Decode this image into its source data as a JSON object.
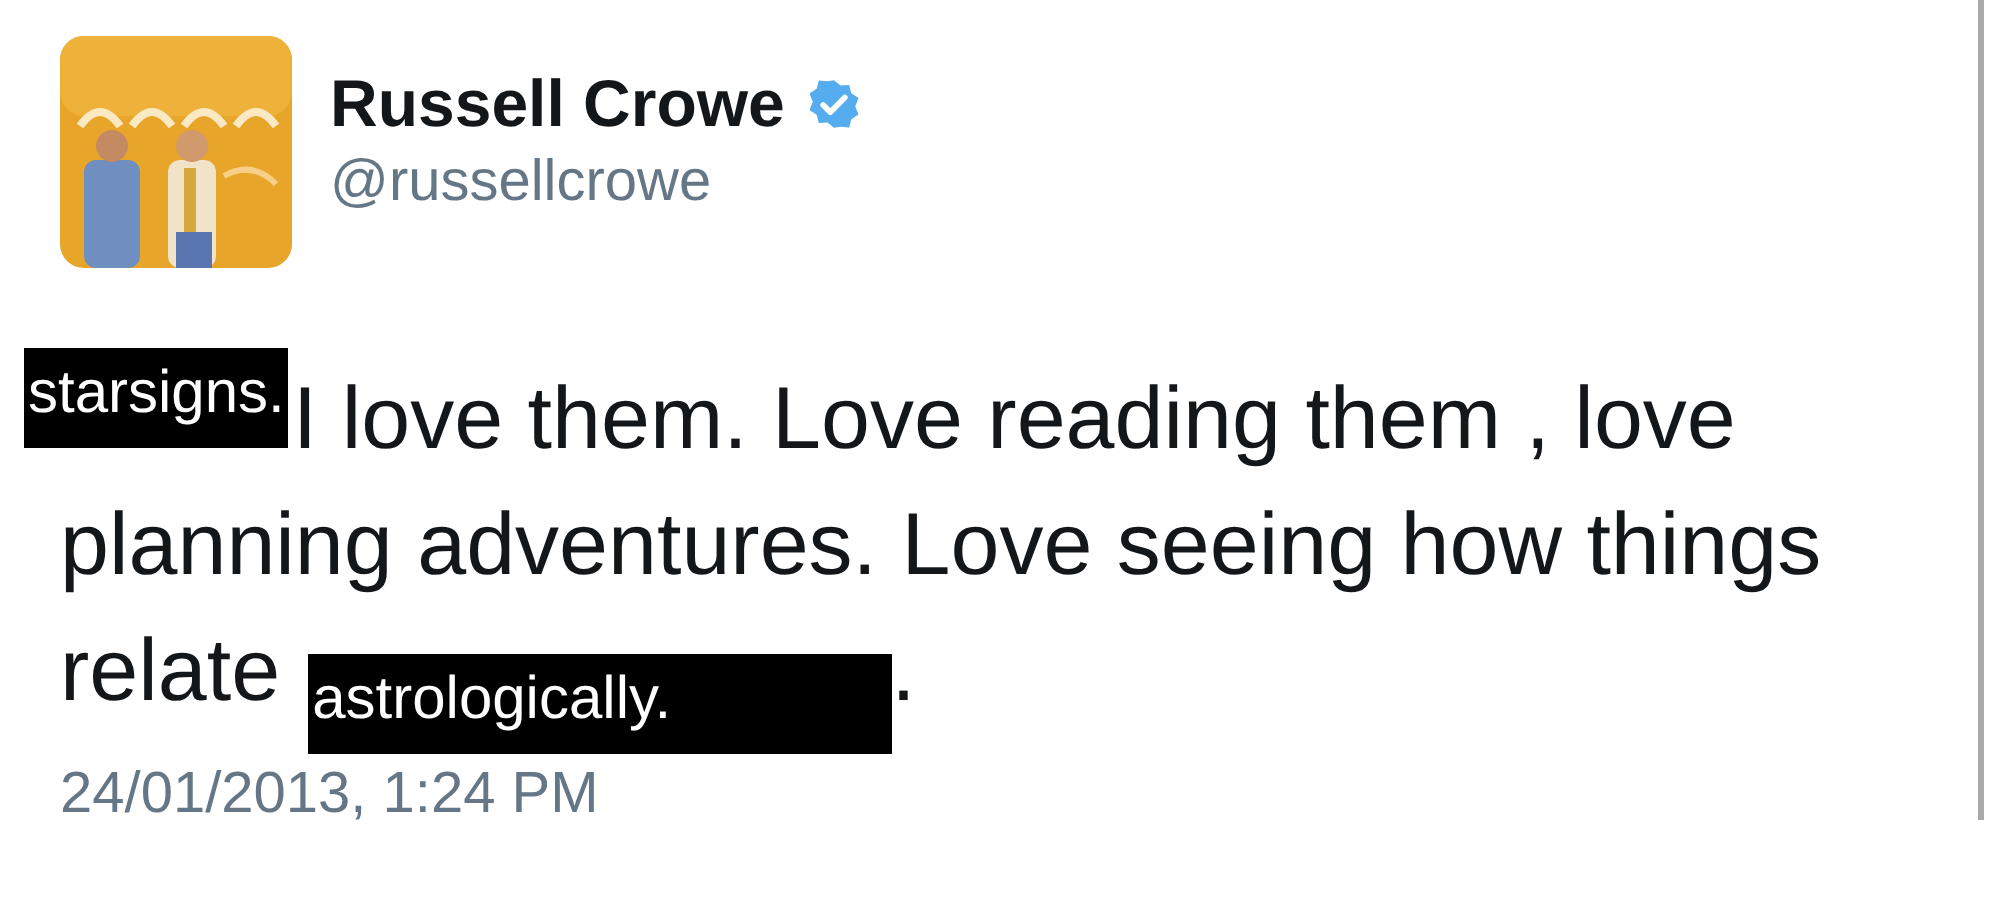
{
  "author": {
    "name": "Russell Crowe",
    "verified": true,
    "handle": "@russellcrowe"
  },
  "tweet_lines": [
    {
      "segments": [
        {
          "kind": "label",
          "text": "starsigns."
        },
        {
          "kind": "text",
          "text": "I love them. Love reading them , love"
        }
      ]
    },
    {
      "segments": [
        {
          "kind": "text",
          "text": "planning adventures. Love seeing how things"
        }
      ]
    },
    {
      "segments": [
        {
          "kind": "text",
          "text": "relate"
        },
        {
          "kind": "label",
          "text": "astrologically."
        },
        {
          "kind": "text",
          "text": "."
        }
      ]
    }
  ],
  "timestamp": "24/01/2013, 1:24 PM"
}
